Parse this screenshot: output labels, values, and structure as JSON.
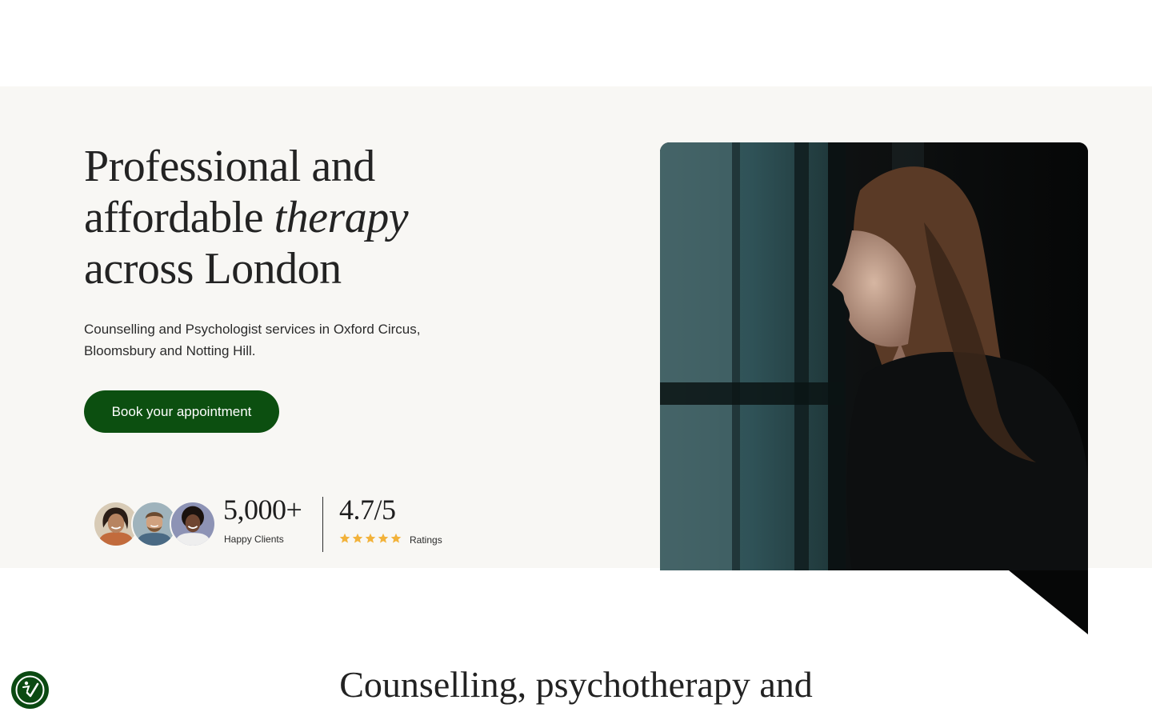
{
  "hero": {
    "title_line1": "Professional and",
    "title_line2_plain": "affordable ",
    "title_line2_italic": "therapy",
    "title_line3": "across London",
    "subtitle": "Counselling and Psychologist services in Oxford Circus, Bloomsbury and Notting Hill.",
    "cta_label": "Book your appointment",
    "image_alt": "Woman looking out of a window"
  },
  "stats": {
    "clients_number": "5,000+",
    "clients_label": "Happy Clients",
    "rating_number": "4.7/5",
    "rating_label": "Ratings",
    "rating_stars": 5
  },
  "section": {
    "title": "Counselling, psychotherapy and"
  },
  "colors": {
    "brand_green": "#0c4f10",
    "hero_background": "#f8f7f4",
    "star_gold": "#f2b23a"
  },
  "icons": {
    "accessibility_button": "accessibility-check-icon",
    "rating": "star-icon"
  }
}
